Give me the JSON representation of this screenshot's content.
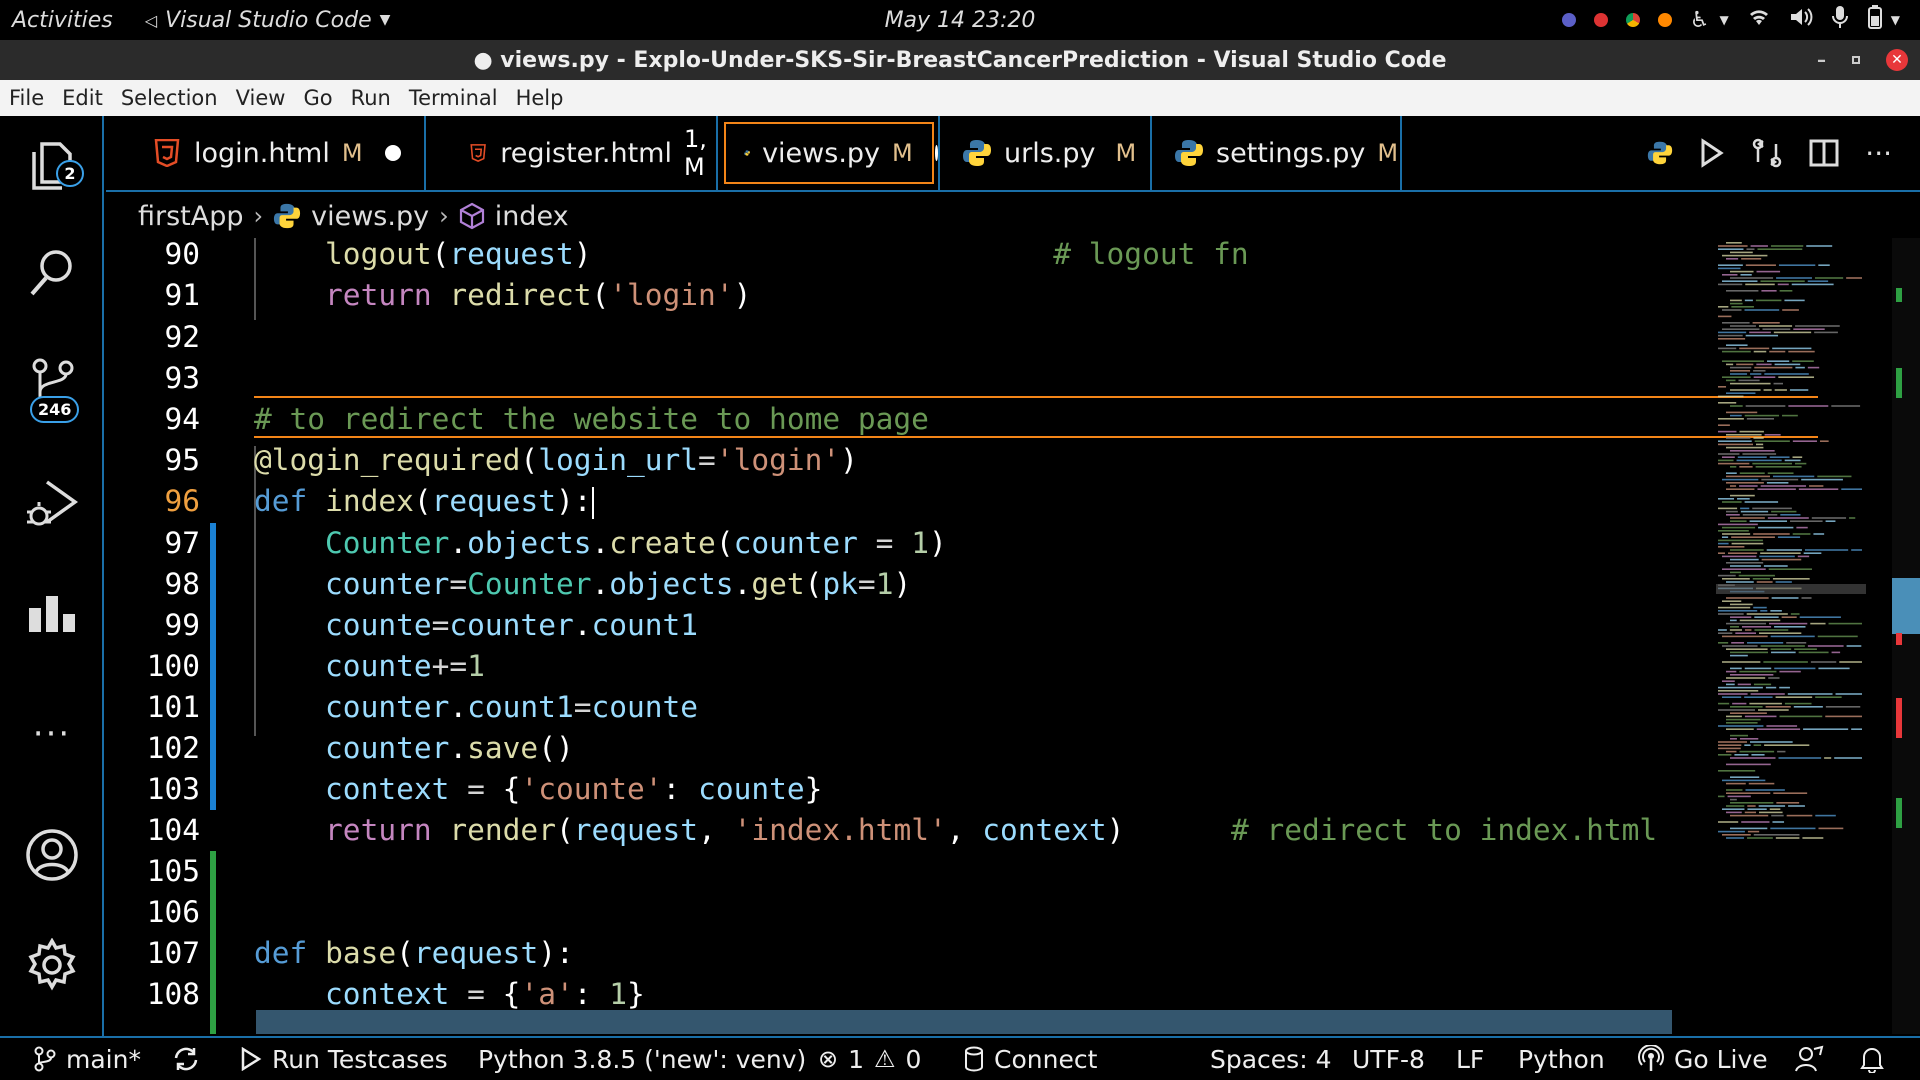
{
  "topbar": {
    "activities": "Activities",
    "app_name": "Visual Studio Code",
    "clock": "May 14  23:20"
  },
  "window": {
    "title": "● views.py - Explo-Under-SKS-Sir-BreastCancerPrediction - Visual Studio Code",
    "minimize": "–",
    "close": "✕"
  },
  "menu": [
    "File",
    "Edit",
    "Selection",
    "View",
    "Go",
    "Run",
    "Terminal",
    "Help"
  ],
  "activity": {
    "explorer_badge": "2",
    "scm_badge": "246"
  },
  "tabs": [
    {
      "label": "login.html",
      "status": "M",
      "icon": "html-file-icon"
    },
    {
      "label": "register.html",
      "status": "1, M",
      "icon": "html-file-icon"
    },
    {
      "label": "views.py",
      "status": "M",
      "icon": "python-file-icon"
    },
    {
      "label": "urls.py",
      "status": "M",
      "icon": "python-file-icon"
    },
    {
      "label": "settings.py",
      "status": "M",
      "icon": "python-file-icon"
    }
  ],
  "breadcrumb": {
    "folder": "firstApp",
    "file": "views.py",
    "symbol": "index"
  },
  "editor": {
    "current_line": "96",
    "line_numbers": [
      "90",
      "91",
      "92",
      "93",
      "94",
      "95",
      "96",
      "97",
      "98",
      "99",
      "100",
      "101",
      "102",
      "103",
      "104",
      "105",
      "106",
      "107",
      "108"
    ]
  },
  "statusbar": {
    "branch": "main*",
    "run": "Run Testcases",
    "interpreter": "Python 3.8.5 ('new': venv)",
    "errors": "1",
    "warnings": "0",
    "connect": "Connect",
    "spaces": "Spaces: 4",
    "encoding": "UTF-8",
    "eol": "LF",
    "language": "Python",
    "golive": "Go Live"
  },
  "colors": {
    "accent_border": "#1a6fa8",
    "active_tab_outline": "#f38518",
    "modified": "#e2c08d",
    "html_icon": "#e44d26",
    "python_blue": "#3b77a8",
    "python_yellow": "#ffd43b"
  }
}
